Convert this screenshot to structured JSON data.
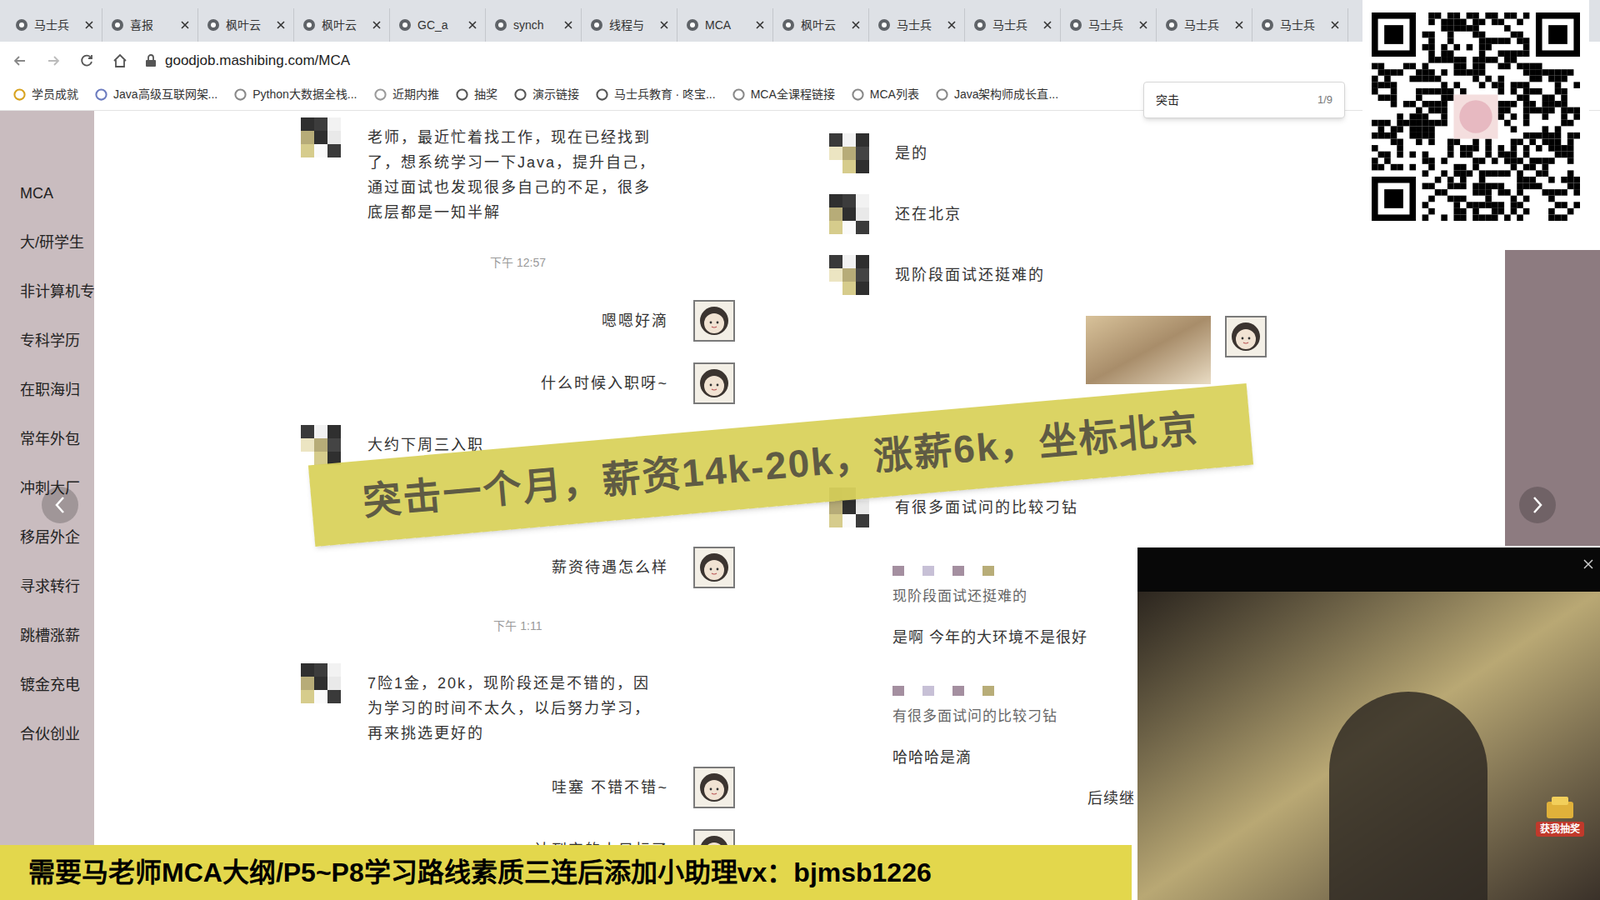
{
  "browser": {
    "tabs": [
      {
        "label": "马士兵"
      },
      {
        "label": "喜报"
      },
      {
        "label": "枫叶云"
      },
      {
        "label": "枫叶云"
      },
      {
        "label": "GC_a"
      },
      {
        "label": "synch"
      },
      {
        "label": "线程与"
      },
      {
        "label": "MCA"
      },
      {
        "label": "枫叶云"
      },
      {
        "label": "马士兵"
      },
      {
        "label": "马士兵"
      },
      {
        "label": "马士兵"
      },
      {
        "label": "马士兵"
      },
      {
        "label": "马士兵"
      }
    ],
    "address": "goodjob.mashibing.com/MCA",
    "bookmarks": [
      "学员成就",
      "Java高级互联网架...",
      "Python大数据全栈...",
      "近期内推",
      "抽奖",
      "演示链接",
      "马士兵教育 · 咚宝...",
      "MCA全课程链接",
      "MCA列表",
      "Java架构师成长直..."
    ],
    "find": {
      "query": "突击",
      "count": "1/9"
    }
  },
  "sidebar": {
    "items": [
      "MCA",
      "大/研学生",
      "非计算机专",
      "专科学历",
      "在职海归",
      "常年外包",
      "冲刺大厂",
      "移居外企",
      "寻求转行",
      "跳槽涨薪",
      "镀金充电",
      "合伙创业"
    ]
  },
  "chat": {
    "left": [
      {
        "kind": "other",
        "text": "老师，最近忙着找工作，现在已经找到了，想系统学习一下Java，提升自己，通过面试也发现很多自己的不足，很多底层都是一知半解"
      },
      {
        "kind": "time",
        "text": "下午 12:57"
      },
      {
        "kind": "me",
        "text": "嗯嗯好滴"
      },
      {
        "kind": "me",
        "text": "什么时候入职呀~"
      },
      {
        "kind": "other",
        "text": "大约下周三入职"
      },
      {
        "kind": "me",
        "text": "薪资待遇怎么样"
      },
      {
        "kind": "time",
        "text": "下午 1:11"
      },
      {
        "kind": "other",
        "text": "7险1金，20k，现阶段还是不错的，因为学习的时间不太久，以后努力学习，再来挑选更好的"
      },
      {
        "kind": "me",
        "text": "哇塞 不错不错~"
      },
      {
        "kind": "me",
        "text": "达到定的小目标了"
      }
    ],
    "right": [
      {
        "kind": "other",
        "text": "是的"
      },
      {
        "kind": "other",
        "text": "还在北京"
      },
      {
        "kind": "other",
        "text": "现阶段面试还挺难的"
      },
      {
        "kind": "image"
      },
      {
        "kind": "other",
        "text": "有很多面试问的比较刁钻"
      },
      {
        "kind": "quote",
        "text": "现阶段面试还挺难的"
      },
      {
        "kind": "plain",
        "text": "是啊 今年的大环境不是很好"
      },
      {
        "kind": "quote",
        "text": "有很多面试问的比较刁钻"
      },
      {
        "kind": "plain",
        "text": "哈哈哈是滴"
      },
      {
        "kind": "cut",
        "text": "后续继"
      }
    ]
  },
  "banner": "突击一个月，薪资14k-20k，涨薪6k，坐标北京",
  "caption": "需要马老师MCA大纲/P5~P8学习路线素质三连后添加小助理vx：bjmsb1226",
  "webcam": {
    "badge": "获我抽奖"
  }
}
